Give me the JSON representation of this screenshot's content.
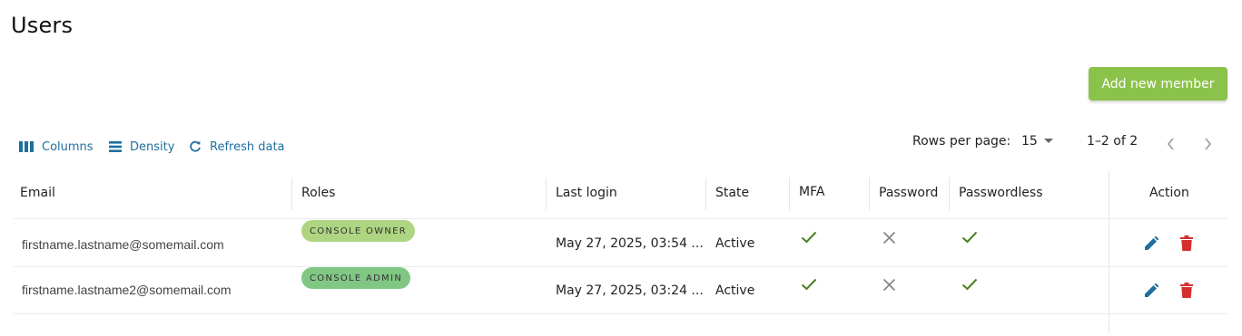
{
  "page": {
    "title": "Users"
  },
  "toolbar": {
    "add_member_label": "Add new member",
    "columns_label": "Columns",
    "density_label": "Density",
    "refresh_label": "Refresh data",
    "rows_per_page_label": "Rows per page:",
    "rows_per_page_value": "15",
    "page_range": "1–2 of 2"
  },
  "table": {
    "headers": {
      "email": "Email",
      "roles": "Roles",
      "last_login": "Last login",
      "state": "State",
      "mfa": "MFA",
      "password": "Password",
      "passwordless": "Passwordless",
      "action": "Action"
    },
    "rows": [
      {
        "email": "firstname.lastname@somemail.com",
        "role": "CONSOLE OWNER",
        "last_login": "May 27, 2025, 03:54 ...",
        "state": "Active",
        "mfa": "check-icon",
        "password": "cross-icon",
        "passwordless": "check-icon"
      },
      {
        "email": "firstname.lastname2@somemail.com",
        "role": "CONSOLE ADMIN",
        "last_login": "May 27, 2025, 03:24 ...",
        "state": "Active",
        "mfa": "check-icon",
        "password": "cross-icon",
        "passwordless": "check-icon"
      }
    ]
  },
  "colors": {
    "accent": "#8bc34a",
    "link": "#1f6f9f",
    "owner_chip": "#aed581",
    "admin_chip": "#81c784",
    "check": "#4a7f1f",
    "cross": "#888888",
    "delete": "#d32f2f"
  }
}
